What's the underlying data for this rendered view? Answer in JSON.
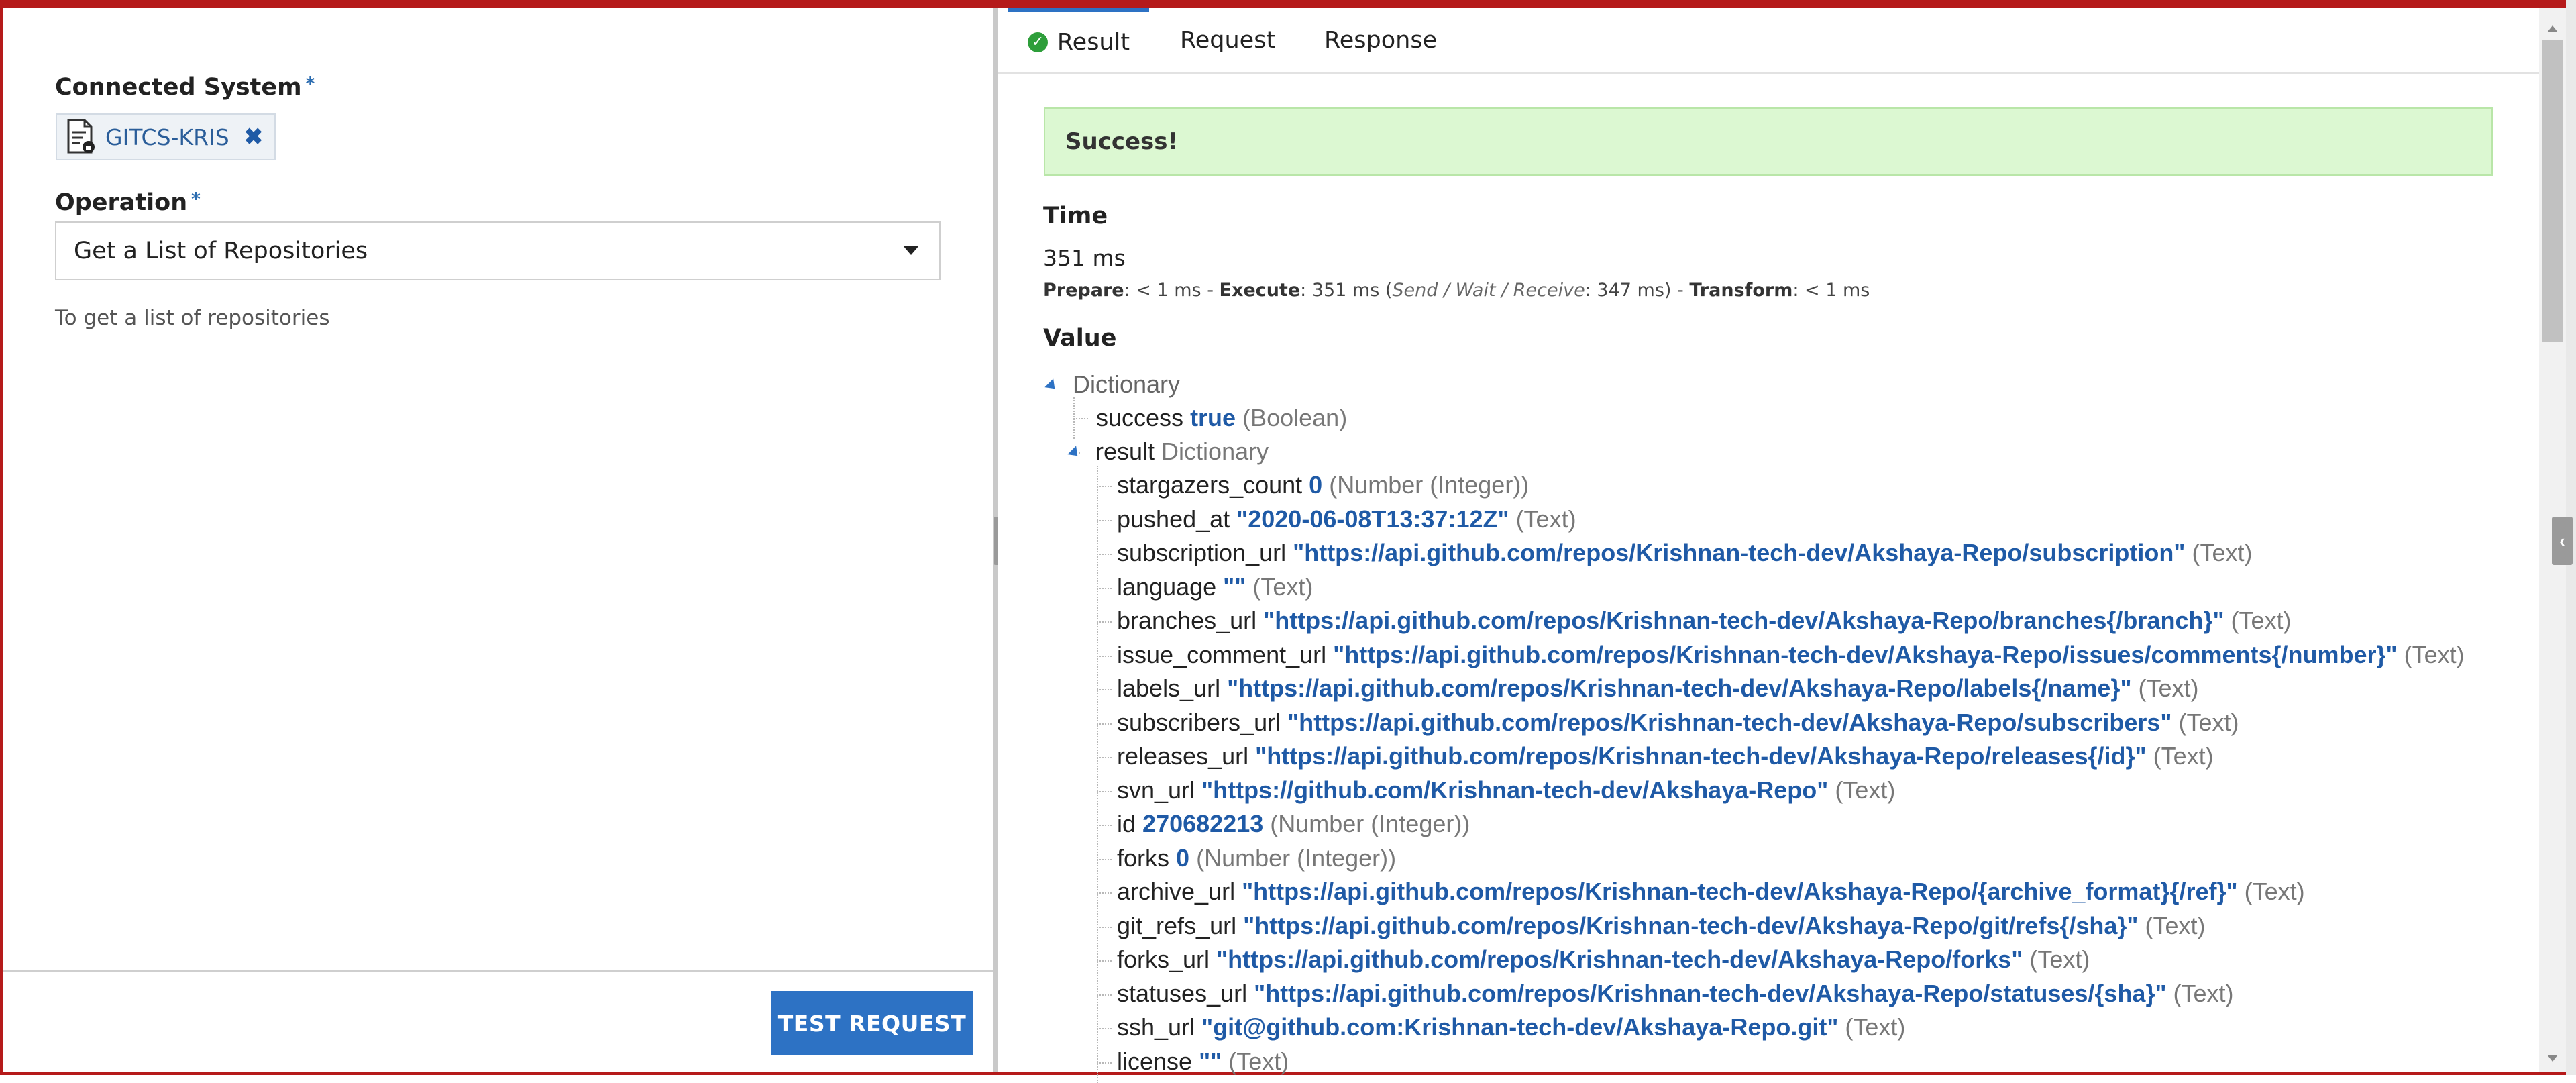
{
  "left": {
    "connected_system_label": "Connected System",
    "required_marker": "*",
    "connected_system_chip": "GITCS-KRIS",
    "operation_label": "Operation",
    "operation_value": "Get a List of Repositories",
    "operation_help": "To get a list of repositories",
    "test_button": "TEST REQUEST"
  },
  "tabs": [
    {
      "label": "Result",
      "active": true
    },
    {
      "label": "Request",
      "active": false
    },
    {
      "label": "Response",
      "active": false
    }
  ],
  "result": {
    "status": "Success!",
    "time_title": "Time",
    "time_value": "351 ms",
    "timing": {
      "prepare_label": "Prepare",
      "prepare_value": ": < 1 ms - ",
      "execute_label": "Execute",
      "execute_value": ": 351 ms (",
      "send_wait_receive": "Send / Wait / Receive",
      "swr_value": ": 347 ms) - ",
      "transform_label": "Transform",
      "transform_value": ": < 1 ms"
    },
    "value_title": "Value",
    "root_type": "Dictionary",
    "success_key": "success",
    "success_value": "true",
    "success_type": "(Boolean)",
    "result_key": "result",
    "result_type": "Dictionary",
    "fields": [
      {
        "key": "stargazers_count",
        "value": "0",
        "type": "(Number (Integer))"
      },
      {
        "key": "pushed_at",
        "value": "\"2020-06-08T13:37:12Z\"",
        "type": "(Text)"
      },
      {
        "key": "subscription_url",
        "value": "\"https://api.github.com/repos/Krishnan-tech-dev/Akshaya-Repo/subscription\"",
        "type": "(Text)"
      },
      {
        "key": "language",
        "value": "\"\"",
        "type": "(Text)"
      },
      {
        "key": "branches_url",
        "value": "\"https://api.github.com/repos/Krishnan-tech-dev/Akshaya-Repo/branches{/branch}\"",
        "type": "(Text)"
      },
      {
        "key": "issue_comment_url",
        "value": "\"https://api.github.com/repos/Krishnan-tech-dev/Akshaya-Repo/issues/comments{/number}\"",
        "type": "(Text)"
      },
      {
        "key": "labels_url",
        "value": "\"https://api.github.com/repos/Krishnan-tech-dev/Akshaya-Repo/labels{/name}\"",
        "type": "(Text)"
      },
      {
        "key": "subscribers_url",
        "value": "\"https://api.github.com/repos/Krishnan-tech-dev/Akshaya-Repo/subscribers\"",
        "type": "(Text)"
      },
      {
        "key": "releases_url",
        "value": "\"https://api.github.com/repos/Krishnan-tech-dev/Akshaya-Repo/releases{/id}\"",
        "type": "(Text)"
      },
      {
        "key": "svn_url",
        "value": "\"https://github.com/Krishnan-tech-dev/Akshaya-Repo\"",
        "type": "(Text)"
      },
      {
        "key": "id",
        "value": "270682213",
        "type": "(Number (Integer))"
      },
      {
        "key": "forks",
        "value": "0",
        "type": "(Number (Integer))"
      },
      {
        "key": "archive_url",
        "value": "\"https://api.github.com/repos/Krishnan-tech-dev/Akshaya-Repo/{archive_format}{/ref}\"",
        "type": "(Text)"
      },
      {
        "key": "git_refs_url",
        "value": "\"https://api.github.com/repos/Krishnan-tech-dev/Akshaya-Repo/git/refs{/sha}\"",
        "type": "(Text)"
      },
      {
        "key": "forks_url",
        "value": "\"https://api.github.com/repos/Krishnan-tech-dev/Akshaya-Repo/forks\"",
        "type": "(Text)"
      },
      {
        "key": "statuses_url",
        "value": "\"https://api.github.com/repos/Krishnan-tech-dev/Akshaya-Repo/statuses/{sha}\"",
        "type": "(Text)"
      },
      {
        "key": "ssh_url",
        "value": "\"git@github.com:Krishnan-tech-dev/Akshaya-Repo.git\"",
        "type": "(Text)"
      },
      {
        "key": "license",
        "value": "\"\"",
        "type": "(Text)"
      }
    ]
  },
  "icons": {
    "chip_icon": "document-lock-icon",
    "chip_remove": "close-icon",
    "tab_status": "check-circle-icon",
    "dropdown": "chevron-down-icon",
    "collapse_left": "chevron-left-icon",
    "tree_toggle": "tree-expanded-icon"
  }
}
